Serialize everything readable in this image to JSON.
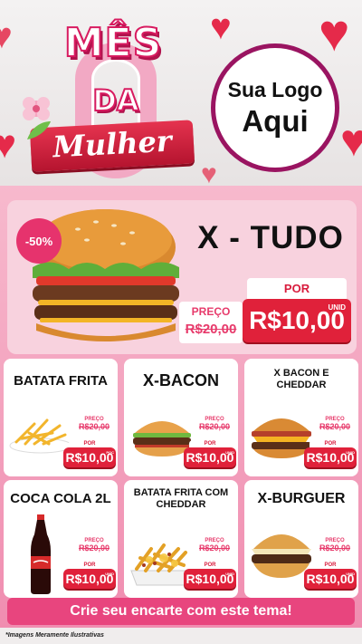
{
  "colors": {
    "accent_pink": "#e8457e",
    "price_red": "#e0213a",
    "heart_red": "#e52a4a",
    "logo_ring": "#9a1461"
  },
  "header": {
    "brand": {
      "line1": "MÊS",
      "line2": "DA",
      "line3": "Mulher"
    },
    "logo": {
      "line1": "Sua Logo",
      "line2": "Aqui"
    }
  },
  "featured": {
    "discount": "-50%",
    "name": "X - TUDO",
    "old_label": "PREÇO",
    "old_price": "R$20,00",
    "new_label": "POR",
    "new_price": "R$10,00",
    "unit": "UNID",
    "icon": "burger-icon"
  },
  "items": [
    {
      "name": "BATATA FRITA",
      "old_label": "PREÇO",
      "old_price": "R$20,00",
      "new_label": "POR",
      "new_price": "R$10,00",
      "unit": "POC",
      "icon": "fries-plate-icon"
    },
    {
      "name": "X-BACON",
      "old_label": "PREÇO",
      "old_price": "R$20,00",
      "new_label": "POR",
      "new_price": "R$10,00",
      "unit": "UNID",
      "icon": "burger-icon"
    },
    {
      "name": "X BACON E CHEDDAR",
      "old_label": "PREÇO",
      "old_price": "R$20,00",
      "new_label": "POR",
      "new_price": "R$10,00",
      "unit": "UNID",
      "icon": "burger-icon"
    },
    {
      "name": "COCA COLA 2L",
      "old_label": "PREÇO",
      "old_price": "R$20,00",
      "new_label": "POR",
      "new_price": "R$10,00",
      "unit": "UNID",
      "icon": "soda-bottle-icon"
    },
    {
      "name": "BATATA FRITA COM CHEDDAR",
      "old_label": "PREÇO",
      "old_price": "R$20,00",
      "new_label": "POR",
      "new_price": "R$10,00",
      "unit": "UNID",
      "icon": "fries-cheddar-icon"
    },
    {
      "name": "X-BURGUER",
      "old_label": "PREÇO",
      "old_price": "R$20,00",
      "new_label": "POR",
      "new_price": "R$10,00",
      "unit": "UNID",
      "icon": "burger-icon"
    }
  ],
  "cta": "Crie seu encarte com este tema!",
  "footer": "*Imagens Meramente Ilustrativas"
}
